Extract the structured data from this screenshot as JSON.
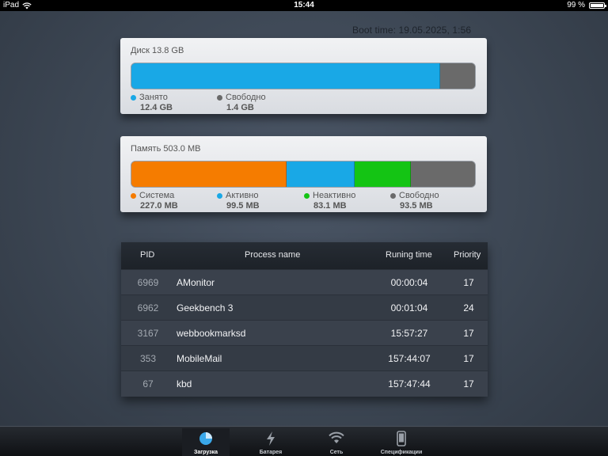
{
  "statusbar": {
    "device": "iPad",
    "time": "15:44",
    "battery": "99 %",
    "battery_level": 0.99
  },
  "boot_time": "Boot time: 19.05.2025, 1:56",
  "disk": {
    "title": "Диск 13.8 GB",
    "segments": [
      {
        "label": "Занято",
        "value": "12.4 GB",
        "amount": 12.4,
        "color": "#19a8e6"
      },
      {
        "label": "Свободно",
        "value": "1.4 GB",
        "amount": 1.4,
        "color": "#6a6a6a"
      }
    ]
  },
  "memory": {
    "title": "Память 503.0 MB",
    "segments": [
      {
        "label": "Система",
        "value": "227.0 MB",
        "amount": 227.0,
        "color": "#f57c00"
      },
      {
        "label": "Активно",
        "value": "99.5 MB",
        "amount": 99.5,
        "color": "#19a8e6"
      },
      {
        "label": "Неактивно",
        "value": "83.1 MB",
        "amount": 83.1,
        "color": "#14c414"
      },
      {
        "label": "Свободно",
        "value": "93.5 MB",
        "amount": 93.5,
        "color": "#6a6a6a"
      }
    ]
  },
  "processes": {
    "headers": {
      "pid": "PID",
      "name": "Process name",
      "time": "Runing time",
      "priority": "Priority"
    },
    "rows": [
      {
        "pid": "6969",
        "name": "AMonitor",
        "time": "00:00:04",
        "priority": "17"
      },
      {
        "pid": "6962",
        "name": "Geekbench 3",
        "time": "00:01:04",
        "priority": "24"
      },
      {
        "pid": "3167",
        "name": "webbookmarksd",
        "time": "15:57:27",
        "priority": "17"
      },
      {
        "pid": "353",
        "name": "MobileMail",
        "time": "157:44:07",
        "priority": "17"
      },
      {
        "pid": "67",
        "name": "kbd",
        "time": "157:47:44",
        "priority": "17"
      }
    ]
  },
  "tabs": [
    {
      "label": "Загрузка",
      "icon": "pie-chart-icon",
      "active": true
    },
    {
      "label": "Батарея",
      "icon": "lightning-icon",
      "active": false
    },
    {
      "label": "Сеть",
      "icon": "wifi-icon",
      "active": false
    },
    {
      "label": "Спецификации",
      "icon": "phone-icon",
      "active": false
    }
  ]
}
